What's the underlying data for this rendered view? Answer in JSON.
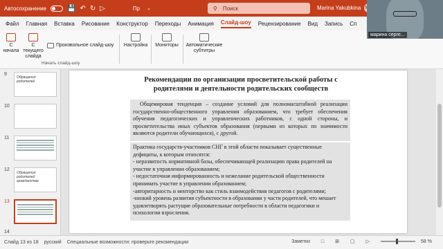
{
  "titlebar": {
    "autosave_label": "Автосохранение",
    "doc_title": "Пр",
    "search_placeholder": "Поиск",
    "user_name": "Marina Yakubkina",
    "user_initials": "MY"
  },
  "tabs": [
    "Файл",
    "Главная",
    "Вставка",
    "Рисование",
    "Конструктор",
    "Переходы",
    "Анимация",
    "Слайд-шоу",
    "Рецензирование",
    "Вид",
    "Запись",
    "Сп"
  ],
  "active_tab": "Слайд-шоу",
  "ribbon": {
    "from_start": "С начала",
    "from_current": "С текущего слайда",
    "custom_show": "Произвольное слайд-шоу",
    "group_label": "Начать слайд-шоу",
    "settings": "Настройка",
    "monitors": "Мониторы",
    "subtitles": "Автоматические субтитры"
  },
  "video": {
    "participant_name": "марина серге..."
  },
  "thumbnails": [
    {
      "num": "9",
      "text": "Обращения родителей"
    },
    {
      "num": "10",
      "text": ""
    },
    {
      "num": "11",
      "text": ""
    },
    {
      "num": "12",
      "text": "Обращения родителей гражданства"
    },
    {
      "num": "13",
      "text": ""
    },
    {
      "num": "14",
      "text": ""
    }
  ],
  "slide": {
    "title": "Рекомендации по организации просветительской работы с родителями и деятельности родительских сообществ",
    "paragraph1": "Общемировая тенденция – создание условий для полномасштабной реализации государственно-общественного управления образованием, что требует обеспечения обучения педагогических и управленческих работников, с одной стороны, и просветительства иных субъектов образования (первыми из которых по значимости являются родители обучающихся), с другой.",
    "intro": "Практика государств-участников СНГ в этой области показывает существенные дефициты, к которым относятся:",
    "items": [
      "- неразвитость нормативной базы, обеспечивающей реализацию права родителей на участие в управлении образованием;",
      "- недостаточная информированность и нежелание родительской общественности принимать участие в управлении образованием;",
      "-авторитарность и менторство как стиль взаимодействия педагогов с родителями;",
      "-низкий уровень развития субъектности в образовании у части родителей, что мешает удовлетворять растущие образовательные потребности в области педагогики и психологии взросления."
    ]
  },
  "zoom_watermark": "zoom",
  "status": {
    "slide_info": "Слайд 13 из 18",
    "language": "русский",
    "accessibility": "Специальные возможности: проверьте рекомендации",
    "notes": "Заметки",
    "zoom_level": "58 %"
  }
}
